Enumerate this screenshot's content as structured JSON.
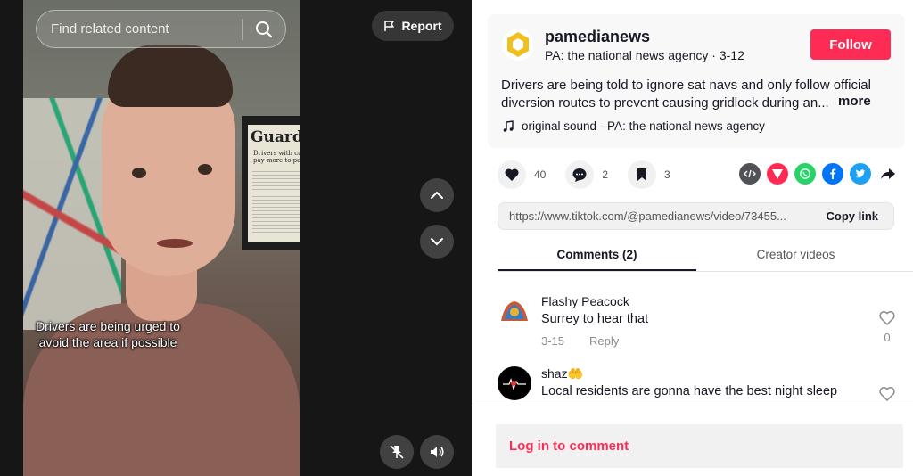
{
  "search": {
    "placeholder": "Find related content"
  },
  "report": {
    "label": "Report"
  },
  "video": {
    "caption": "Drivers are being urged to avoid the area if possible",
    "newspaper_masthead": "Guardian",
    "newspaper_headline": "Drivers with cash pay more to park"
  },
  "author": {
    "username": "pamedianews",
    "subtitle": "PA: the national news agency · 3-12",
    "follow_label": "Follow"
  },
  "description": {
    "line1": "Drivers are being told to ignore sat navs and only follow official",
    "line2": "diversion routes to prevent causing gridlock during an...",
    "more_label": "more"
  },
  "sound": {
    "label": "original sound - PA: the national news agency"
  },
  "stats": {
    "likes": "40",
    "comments": "2",
    "saves": "3"
  },
  "share": {
    "icons": [
      "embed-icon",
      "send-icon",
      "whatsapp-icon",
      "facebook-icon",
      "twitter-icon",
      "share-arrow-icon"
    ],
    "colors": {
      "embed": "#505258",
      "send": "#fe2c55",
      "whatsapp": "#25d366",
      "facebook": "#0075fa",
      "twitter": "#1da1f2"
    }
  },
  "link": {
    "url": "https://www.tiktok.com/@pamedianews/video/73455...",
    "copy_label": "Copy link"
  },
  "tabs": [
    {
      "label": "Comments (2)",
      "active": true
    },
    {
      "label": "Creator videos",
      "active": false
    }
  ],
  "comments": [
    {
      "user": "Flashy Peacock",
      "text": "Surrey to hear that",
      "date": "3-15",
      "reply_label": "Reply",
      "likes": "0"
    },
    {
      "user": "shaz🤲",
      "text": "Local residents are gonna have the best night sleep",
      "date": "",
      "reply_label": "",
      "likes": ""
    }
  ],
  "login": {
    "label": "Log in to comment"
  },
  "colors": {
    "accent": "#fe2c55",
    "text": "#161823",
    "muted": "#8a8b91"
  }
}
